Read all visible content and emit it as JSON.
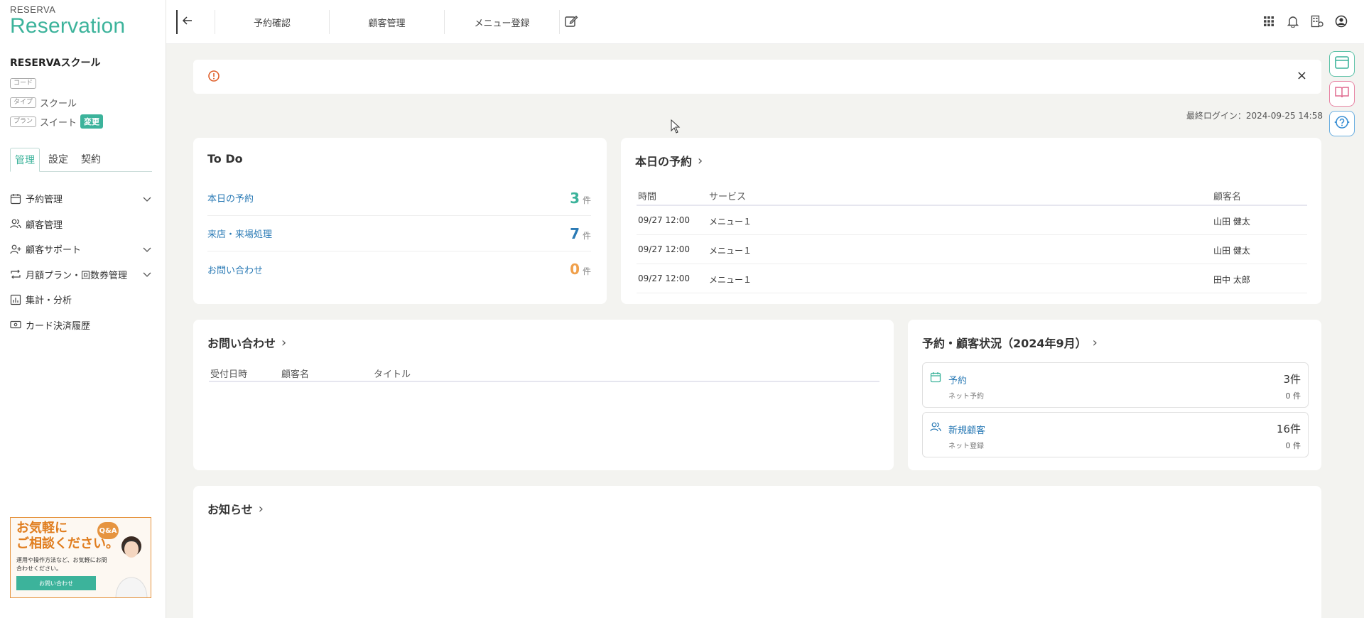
{
  "brand": {
    "small": "RESERVA",
    "big": "Reservation"
  },
  "school": {
    "name": "RESERVAスクール",
    "code_tag": "コード",
    "type_tag": "タイプ",
    "type_value": "スクール",
    "plan_tag": "プラン",
    "plan_value": "スイート",
    "change_label": "変更"
  },
  "sidebar": {
    "tabs": [
      "管理",
      "設定",
      "契約"
    ],
    "items": [
      {
        "label": "予約管理",
        "icon": "calendar-icon",
        "expandable": true
      },
      {
        "label": "顧客管理",
        "icon": "users-icon",
        "expandable": false
      },
      {
        "label": "顧客サポート",
        "icon": "user-plus-icon",
        "expandable": true
      },
      {
        "label": "月額プラン・回数券管理",
        "icon": "repeat-icon",
        "expandable": true
      },
      {
        "label": "集計・分析",
        "icon": "chart-icon",
        "expandable": false
      },
      {
        "label": "カード決済履歴",
        "icon": "card-icon",
        "expandable": false
      }
    ],
    "banner": {
      "line1": "お気軽に",
      "line2": "ご相談ください。",
      "body": "運用や操作方法など、お気軽にお問合わせください。",
      "button": "お問い合わせ",
      "badge": "Q&A"
    }
  },
  "topbar": {
    "nav": [
      "予約確認",
      "顧客管理",
      "メニュー登録"
    ]
  },
  "alert": {
    "close": "×"
  },
  "last_login": "最終ログイン：2024-09-25 14:58",
  "todo": {
    "title": "To Do",
    "unit": "件",
    "rows": [
      {
        "label": "本日の予約",
        "count": "3",
        "color": "#3cb39b"
      },
      {
        "label": "来店・来場処理",
        "count": "7",
        "color": "#2a7ab5"
      },
      {
        "label": "お問い合わせ",
        "count": "0",
        "color": "#f0a04b"
      }
    ]
  },
  "today": {
    "title": "本日の予約",
    "headers": {
      "time": "時間",
      "service": "サービス",
      "customer": "顧客名"
    },
    "rows": [
      {
        "time": "09/27 12:00",
        "service": "メニュー１",
        "customer": "山田 健太"
      },
      {
        "time": "09/27 12:00",
        "service": "メニュー１",
        "customer": "山田 健太"
      },
      {
        "time": "09/27 12:00",
        "service": "メニュー１",
        "customer": "田中 太郎"
      }
    ]
  },
  "inquiries": {
    "title": "お問い合わせ",
    "headers": {
      "date": "受付日時",
      "customer": "顧客名",
      "title": "タイトル"
    }
  },
  "status": {
    "title": "予約・顧客状況（2024年9月）",
    "boxes": [
      {
        "label": "予約",
        "sub": "ネット予約",
        "value": "3件",
        "sub_value": "0 件",
        "icon": "calendar-icon"
      },
      {
        "label": "新規顧客",
        "sub": "ネット登録",
        "value": "16件",
        "sub_value": "0 件",
        "icon": "users-icon"
      }
    ]
  },
  "news": {
    "title": "お知らせ"
  },
  "colors": {
    "accent": "#3cb39b",
    "link": "#2a7ab5",
    "warn": "#e07d1e"
  }
}
